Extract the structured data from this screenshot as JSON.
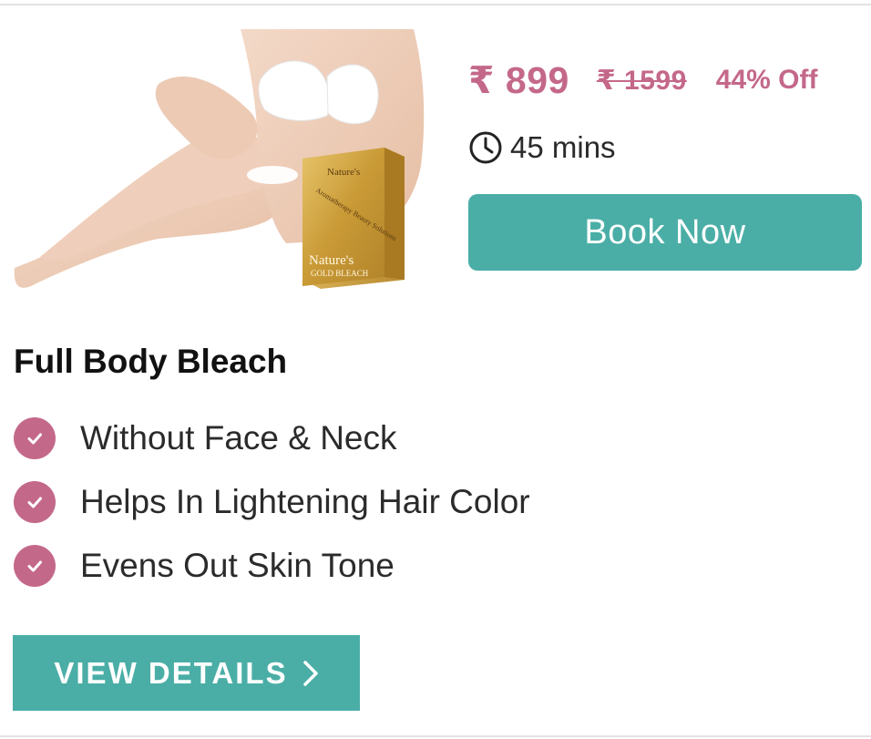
{
  "service": {
    "title": "Full Body Bleach",
    "price_current": "₹ 899",
    "price_original": "₹ 1599",
    "discount": "44% Off",
    "duration": "45 mins",
    "image_icon": "woman-applying-bleach-with-product-box"
  },
  "product_box": {
    "brand": "Nature's",
    "tagline": "Aromatherapy Beauty Solutions",
    "name_line1": "Nature's",
    "name_line2": "GOLD BLEACH"
  },
  "features": [
    {
      "text": "Without Face & Neck",
      "icon": "check-circle-icon"
    },
    {
      "text": "Helps In Lightening Hair Color",
      "icon": "check-circle-icon"
    },
    {
      "text": "Evens Out Skin Tone",
      "icon": "check-circle-icon"
    }
  ],
  "actions": {
    "book_now_label": "Book Now",
    "view_details_label": "VIEW DETAILS"
  },
  "colors": {
    "accent_pink": "#c4688a",
    "accent_teal": "#4aaea6",
    "text_dark": "#111111"
  }
}
